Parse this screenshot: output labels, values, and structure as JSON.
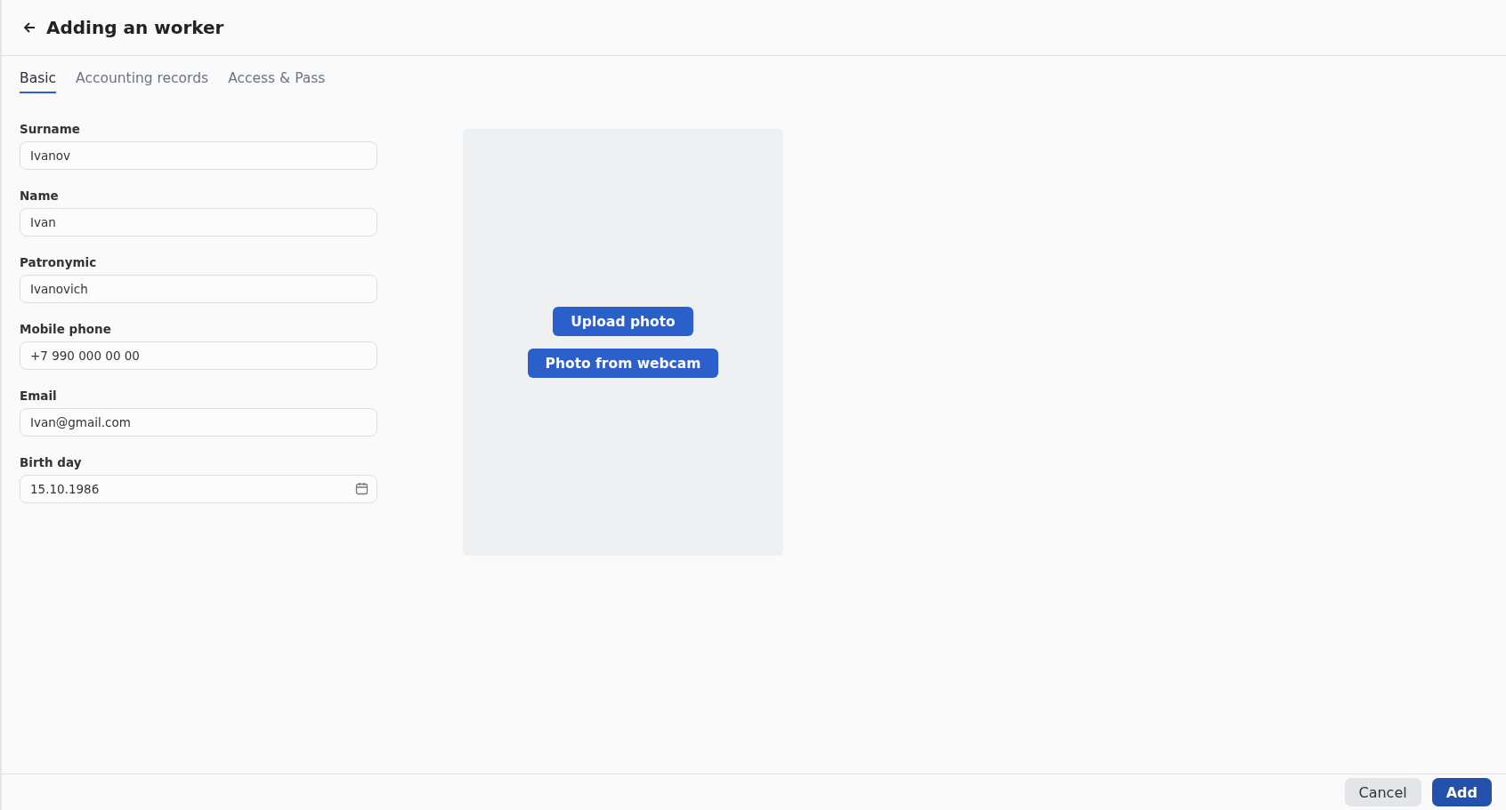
{
  "header": {
    "title": "Adding an worker"
  },
  "tabs": [
    {
      "label": "Basic",
      "selected": true
    },
    {
      "label": "Accounting records",
      "selected": false
    },
    {
      "label": "Access & Pass",
      "selected": false
    }
  ],
  "fields": [
    {
      "label": "Surname",
      "value": "Ivanov",
      "kind": "text"
    },
    {
      "label": "Name",
      "value": "Ivan",
      "kind": "text"
    },
    {
      "label": "Patronymic",
      "value": "Ivanovich",
      "kind": "text"
    },
    {
      "label": "Mobile phone",
      "value": "+7 990 000 00 00",
      "kind": "text"
    },
    {
      "label": "Email",
      "value": "Ivan@gmail.com",
      "kind": "text"
    },
    {
      "label": "Birth day",
      "value": "15.10.1986",
      "kind": "date"
    }
  ],
  "photo": {
    "buttons": [
      "Upload photo",
      "Photo from webcam"
    ]
  },
  "footer": {
    "buttons": [
      {
        "label": "Cancel",
        "kind": "secondary"
      },
      {
        "label": "Add",
        "kind": "primary"
      }
    ]
  }
}
